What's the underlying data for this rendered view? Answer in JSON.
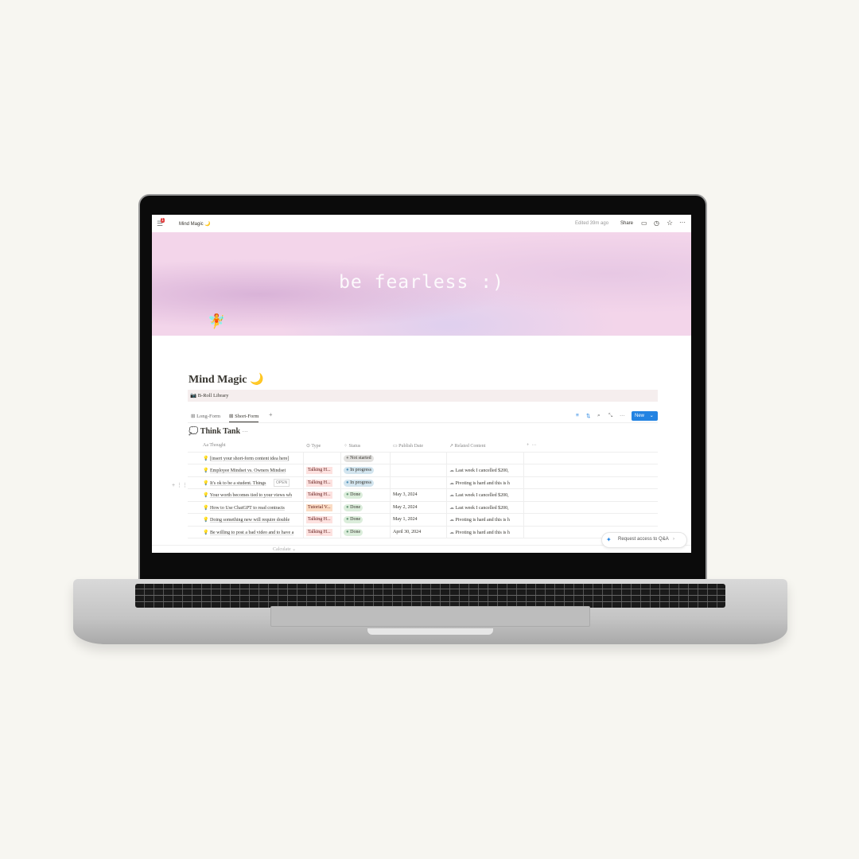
{
  "topbar": {
    "badge": "1",
    "breadcrumb": "Mind Magic 🌙",
    "edited": "Edited 39m ago",
    "share": "Share"
  },
  "banner": {
    "text": "be fearless :)"
  },
  "page": {
    "title": "Mind Magic 🌙",
    "linked_page": "B-Roll Library"
  },
  "tabs": [
    {
      "label": "Long-Form"
    },
    {
      "label": "Short-Form",
      "active": true
    }
  ],
  "toolbar": {
    "new_label": "New"
  },
  "database": {
    "title": "Think Tank",
    "columns": [
      "Thought",
      "Type",
      "Status",
      "Publish Date",
      "Related Content"
    ],
    "rows": [
      {
        "thought": "[insert your short-form content idea here]",
        "type": "",
        "status": "Not started",
        "date": "",
        "related": ""
      },
      {
        "thought": "Employee Mindset vs. Owners Mindset",
        "type": "Talking H...",
        "status": "In progress",
        "date": "",
        "related": "Last week I cancelled $200,"
      },
      {
        "thought": "It's ok to be a student. Things",
        "type": "Talking H...",
        "status": "In progress",
        "date": "",
        "related": "Pivoting is hard and this is h",
        "open": "OPEN"
      },
      {
        "thought": "Your worth becomes tied to your views wh",
        "type": "Talking H...",
        "status": "Done",
        "date": "May 3, 2024",
        "related": "Last week I cancelled $200,"
      },
      {
        "thought": "How to Use ChatGPT to read contracts",
        "type": "Tutorial V...",
        "status": "Done",
        "date": "May 2, 2024",
        "related": "Last week I cancelled $200,"
      },
      {
        "thought": "Doing something new will require double",
        "type": "Talking H...",
        "status": "Done",
        "date": "May 1, 2024",
        "related": "Pivoting is hard and this is h"
      },
      {
        "thought": "Be willing to post a bad video and to have a",
        "type": "Talking H...",
        "status": "Done",
        "date": "April 30, 2024",
        "related": "Pivoting is hard and this is h"
      }
    ],
    "calculate": "Calculate"
  },
  "request_access": "Request access to Q&A",
  "colors": {
    "accent": "#2383e2",
    "talking": "#fde2e0",
    "tutorial": "#fbdcc4",
    "not_started": "#e3e2e0",
    "in_progress": "#d3e5ef",
    "done": "#dbeddb"
  }
}
